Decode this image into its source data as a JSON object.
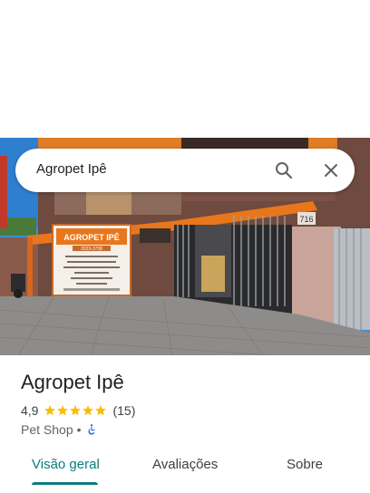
{
  "search": {
    "query": "Agropet Ipê"
  },
  "photo": {
    "facade_number": "716",
    "sign_title": "AGROPET IPÊ",
    "sign_phone": "2023-3738"
  },
  "place": {
    "name": "Agropet Ipê",
    "rating": "4,9",
    "stars": 5,
    "review_count": "(15)",
    "category": "Pet Shop",
    "separator": "•"
  },
  "tabs": [
    {
      "label": "Visão geral",
      "active": true
    },
    {
      "label": "Avaliações",
      "active": false
    },
    {
      "label": "Sobre",
      "active": false
    }
  ],
  "colors": {
    "accent": "#0a7d7c",
    "star": "#fbbc04",
    "a11y_icon": "#1a73e8"
  },
  "icons": {
    "search": "search-icon",
    "close": "close-icon",
    "accessibility": "wheelchair-icon"
  }
}
